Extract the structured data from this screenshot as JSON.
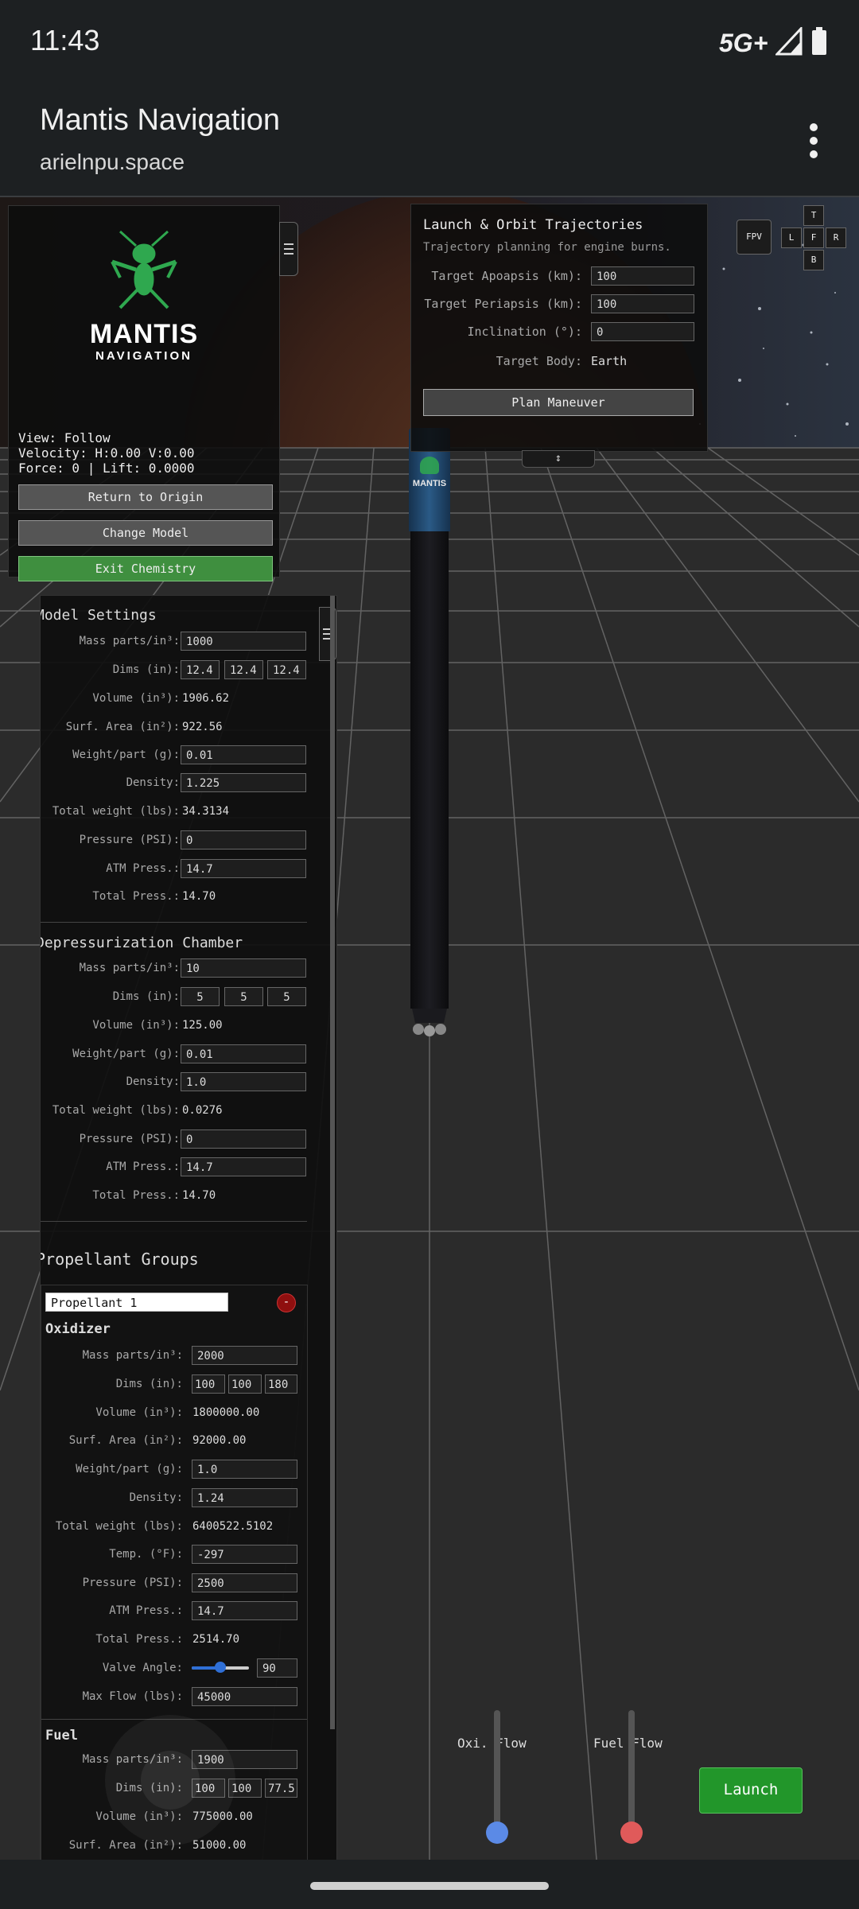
{
  "status_bar": {
    "time": "11:43",
    "network": "5G+"
  },
  "app_bar": {
    "title": "Mantis Navigation",
    "url": "arielnpu.space"
  },
  "logo": {
    "line1": "MANTIS",
    "line2": "NAVIGATION",
    "color": "#2fa84f"
  },
  "hud": {
    "view": "View: Follow",
    "velocity": "Velocity: H:0.00 V:0.00",
    "force": "Force: 0 | Lift: 0.0000",
    "return_label": "Return to Origin",
    "change_label": "Change Model",
    "exit_label": "Exit Chemistry"
  },
  "trajectory": {
    "title": "Launch & Orbit Trajectories",
    "subtitle": "Trajectory planning for engine burns.",
    "apo_label": "Target Apoapsis (km):",
    "apo_value": "100",
    "peri_label": "Target Periapsis (km):",
    "peri_value": "100",
    "inc_label": "Inclination (°):",
    "inc_value": "0",
    "body_label": "Target Body:",
    "body_value": "Earth",
    "plan_label": "Plan Maneuver"
  },
  "camera": {
    "fpv": "FPV",
    "t": "T",
    "l": "L",
    "f": "F",
    "r": "R",
    "b": "B"
  },
  "model_settings": {
    "title": "Model Settings",
    "mass_label": "Mass parts/in³:",
    "mass_value": "1000",
    "dims_label": "Dims (in):",
    "dim1": "12.4",
    "dim2": "12.4",
    "dim3": "12.4",
    "volume_label": "Volume (in³):",
    "volume_value": "1906.62",
    "surf_label": "Surf. Area (in²):",
    "surf_value": "922.56",
    "wpp_label": "Weight/part (g):",
    "wpp_value": "0.01",
    "density_label": "Density:",
    "density_value": "1.225",
    "total_label": "Total weight (lbs):",
    "total_value": "34.3134",
    "psi_label": "Pressure (PSI):",
    "psi_value": "0",
    "atm_label": "ATM Press.:",
    "atm_value": "14.7",
    "tp_label": "Total Press.:",
    "tp_value": "14.70"
  },
  "depress": {
    "title": "Depressurization Chamber",
    "mass_label": "Mass parts/in³:",
    "mass_value": "10",
    "dims_label": "Dims (in):",
    "dim1": "5",
    "dim2": "5",
    "dim3": "5",
    "volume_label": "Volume (in³):",
    "volume_value": "125.00",
    "wpp_label": "Weight/part (g):",
    "wpp_value": "0.01",
    "density_label": "Density:",
    "density_value": "1.0",
    "total_label": "Total weight (lbs):",
    "total_value": "0.0276",
    "psi_label": "Pressure (PSI):",
    "psi_value": "0",
    "atm_label": "ATM Press.:",
    "atm_value": "14.7",
    "tp_label": "Total Press.:",
    "tp_value": "14.70"
  },
  "propellant": {
    "title": "Propellant Groups",
    "group_name": "Propellant 1",
    "remove_symbol": "-",
    "ox_title": "Oxidizer",
    "ox": {
      "mass_label": "Mass parts/in³:",
      "mass_value": "2000",
      "dims_label": "Dims (in):",
      "dim1": "100",
      "dim2": "100",
      "dim3": "180",
      "volume_label": "Volume (in³):",
      "volume_value": "1800000.00",
      "surf_label": "Surf. Area (in²):",
      "surf_value": "92000.00",
      "wpp_label": "Weight/part (g):",
      "wpp_value": "1.0",
      "density_label": "Density:",
      "density_value": "1.24",
      "total_label": "Total weight (lbs):",
      "total_value": "6400522.5102",
      "temp_label": "Temp. (°F):",
      "temp_value": "-297",
      "psi_label": "Pressure (PSI):",
      "psi_value": "2500",
      "atm_label": "ATM Press.:",
      "atm_value": "14.7",
      "tp_label": "Total Press.:",
      "tp_value": "2514.70",
      "valve_label": "Valve Angle:",
      "valve_value": "90",
      "maxflow_label": "Max Flow (lbs):",
      "maxflow_value": "45000"
    },
    "fuel_title": "Fuel",
    "fuel": {
      "mass_label": "Mass parts/in³:",
      "mass_value": "1900",
      "dims_label": "Dims (in):",
      "dim1": "100",
      "dim2": "100",
      "dim3": "77.5",
      "volume_label": "Volume (in³):",
      "volume_value": "775000.00",
      "surf_label": "Surf. Area (in²):",
      "surf_value": "51000.00"
    }
  },
  "flow": {
    "oxi_label": "Oxi. Flow",
    "fuel_label": "Fuel Flow",
    "oxi_color": "#5b8ae6",
    "fuel_color": "#e05a5a",
    "oxi_level": 0,
    "fuel_level": 0
  },
  "launch_label": "Launch",
  "colors": {
    "exit_green": "#3f8f3f",
    "launch_green": "#22962a",
    "remove_red": "#8f0f0f"
  }
}
